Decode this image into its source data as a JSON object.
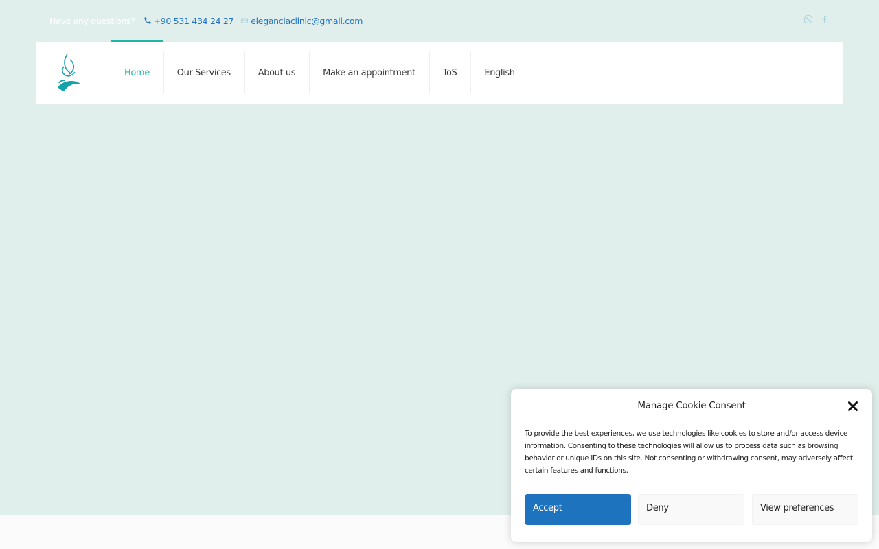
{
  "topbar": {
    "question": "Have any questions?",
    "phone": "+90 531 434 24 27",
    "email": "eleganciaclinic@gmail.com"
  },
  "social": {
    "icons": [
      "whatsapp-icon",
      "facebook-icon"
    ]
  },
  "nav": {
    "items": [
      {
        "label": "Home",
        "active": true
      },
      {
        "label": "Our Services",
        "active": false
      },
      {
        "label": "About us",
        "active": false
      },
      {
        "label": "Make an appointment",
        "active": false
      },
      {
        "label": "ToS",
        "active": false
      },
      {
        "label": "English",
        "active": false
      }
    ]
  },
  "cookie": {
    "title": "Manage Cookie Consent",
    "text": "To provide the best experiences, we use technologies like cookies to store and/or access device information. Consenting to these technologies will allow us to process data such as browsing behavior or unique IDs on this site. Not consenting or withdrawing consent, may adversely affect certain features and functions.",
    "accept": "Accept",
    "deny": "Deny",
    "preferences": "View preferences"
  },
  "colors": {
    "accent": "#21b5aa",
    "link": "#1f73c7",
    "button": "#1e73be",
    "background": "#e1efec"
  }
}
